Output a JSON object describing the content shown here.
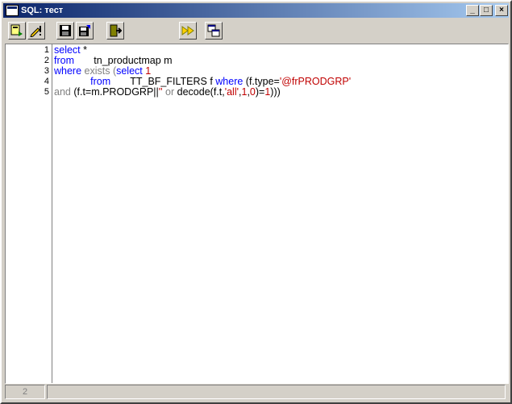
{
  "window": {
    "title": "SQL: тест",
    "controls": {
      "minimize": "_",
      "maximize": "□",
      "close": "×"
    }
  },
  "toolbar": {
    "buttons": [
      {
        "name": "run-query",
        "icon": "run-icon"
      },
      {
        "name": "edit",
        "icon": "pencil-icon"
      },
      {
        "name": "save",
        "icon": "save-icon"
      },
      {
        "name": "save-as",
        "icon": "save-as-icon"
      },
      {
        "name": "exit",
        "icon": "exit-icon"
      },
      {
        "name": "fast-forward",
        "icon": "fast-forward-icon"
      },
      {
        "name": "window",
        "icon": "window-icon"
      }
    ]
  },
  "editor": {
    "line_numbers": [
      "1",
      "2",
      "3",
      "4",
      "5"
    ],
    "lines": [
      [
        {
          "t": "select",
          "c": "kw"
        },
        {
          "t": " *",
          "c": "id"
        }
      ],
      [
        {
          "t": "from",
          "c": "kw"
        },
        {
          "t": "       tn_productmap m",
          "c": "id"
        }
      ],
      [
        {
          "t": "where",
          "c": "kw"
        },
        {
          "t": " exists (",
          "c": "gray"
        },
        {
          "t": "select",
          "c": "kw"
        },
        {
          "t": " 1",
          "c": "num"
        }
      ],
      [
        {
          "t": "             ",
          "c": "id"
        },
        {
          "t": "from",
          "c": "kw"
        },
        {
          "t": "       TT_BF_FILTERS f ",
          "c": "id"
        },
        {
          "t": "where",
          "c": "kw"
        },
        {
          "t": " (f.type=",
          "c": "id"
        },
        {
          "t": "'@frPRODGRP'",
          "c": "str"
        }
      ],
      [
        {
          "t": "and",
          "c": "gray"
        },
        {
          "t": " (f.t=m.PRODGRP||",
          "c": "id"
        },
        {
          "t": "''",
          "c": "str"
        },
        {
          "t": " or ",
          "c": "gray"
        },
        {
          "t": "decode",
          "c": "id"
        },
        {
          "t": "(f.t,",
          "c": "id"
        },
        {
          "t": "'all'",
          "c": "str"
        },
        {
          "t": ",",
          "c": "id"
        },
        {
          "t": "1",
          "c": "num"
        },
        {
          "t": ",",
          "c": "id"
        },
        {
          "t": "0",
          "c": "num"
        },
        {
          "t": ")=",
          "c": "id"
        },
        {
          "t": "1",
          "c": "num"
        },
        {
          "t": ")))",
          "c": "id"
        }
      ]
    ]
  },
  "status": {
    "cell1": "2",
    "cell2": ""
  }
}
